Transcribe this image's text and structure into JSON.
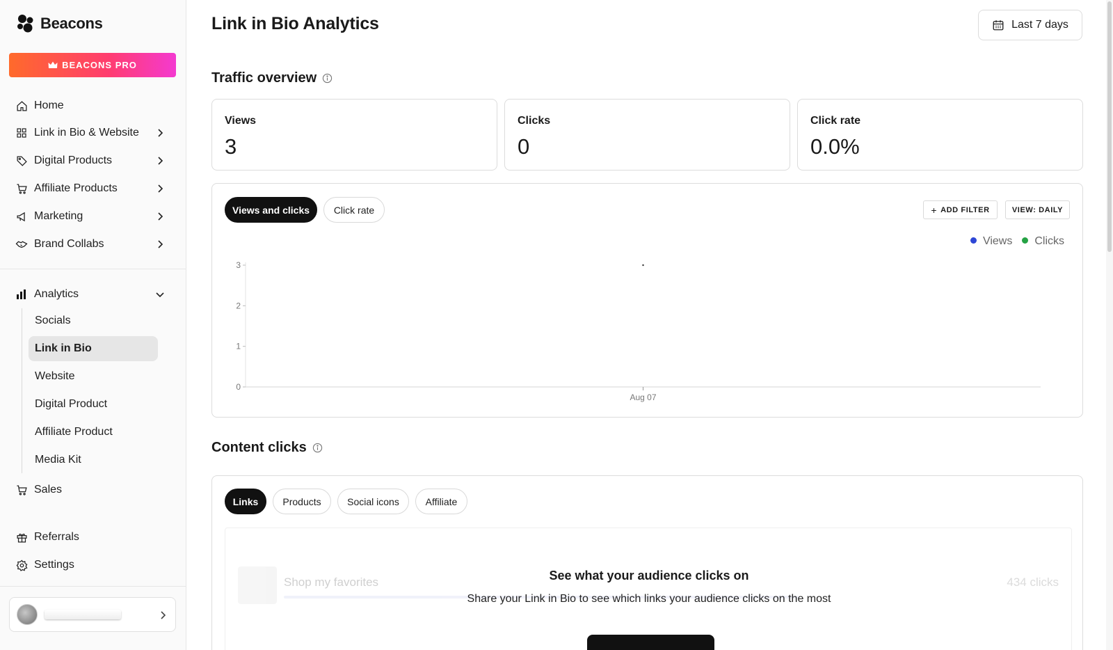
{
  "brand": {
    "name": "Beacons",
    "pro_label": "BEACONS PRO",
    "pro_gradient": [
      "#ff6a2b",
      "#ff3c70",
      "#f43ad0"
    ]
  },
  "sidebar": {
    "items": [
      {
        "label": "Home",
        "icon": "home-icon",
        "has_chevron": false
      },
      {
        "label": "Link in Bio & Website",
        "icon": "grid-icon",
        "has_chevron": true
      },
      {
        "label": "Digital Products",
        "icon": "tag-icon",
        "has_chevron": true
      },
      {
        "label": "Affiliate Products",
        "icon": "cart-icon",
        "has_chevron": true
      },
      {
        "label": "Marketing",
        "icon": "megaphone-icon",
        "has_chevron": true
      },
      {
        "label": "Brand Collabs",
        "icon": "handshake-icon",
        "has_chevron": true
      }
    ],
    "analytics": {
      "label": "Analytics",
      "icon": "bar-chart-icon",
      "expanded": true,
      "sub_items": [
        {
          "label": "Socials",
          "active": false
        },
        {
          "label": "Link in Bio",
          "active": true
        },
        {
          "label": "Website",
          "active": false
        },
        {
          "label": "Digital Product",
          "active": false
        },
        {
          "label": "Affiliate Product",
          "active": false
        },
        {
          "label": "Media Kit",
          "active": false
        }
      ]
    },
    "sales": {
      "label": "Sales",
      "icon": "cart-icon"
    },
    "bottom_items": [
      {
        "label": "Referrals",
        "icon": "gift-icon"
      },
      {
        "label": "Settings",
        "icon": "gear-icon"
      }
    ]
  },
  "header": {
    "title": "Link in Bio Analytics",
    "date_range": "Last 7 days"
  },
  "traffic": {
    "title": "Traffic overview",
    "stats": [
      {
        "label": "Views",
        "value": "3"
      },
      {
        "label": "Clicks",
        "value": "0"
      },
      {
        "label": "Click rate",
        "value": "0.0%"
      }
    ],
    "tabs": [
      {
        "label": "Views and clicks",
        "active": true
      },
      {
        "label": "Click rate",
        "active": false
      }
    ],
    "add_filter": "ADD FILTER",
    "view_mode": "VIEW: DAILY",
    "legend": [
      {
        "name": "Views",
        "color": "#2e47d6"
      },
      {
        "name": "Clicks",
        "color": "#25a244"
      }
    ]
  },
  "chart_data": {
    "type": "line",
    "x": [
      "Aug 07"
    ],
    "series": [
      {
        "name": "Views",
        "values": [
          3
        ]
      },
      {
        "name": "Clicks",
        "values": [
          0
        ]
      }
    ],
    "yticks": [
      0,
      1,
      2,
      3
    ],
    "ylim": [
      0,
      3
    ],
    "legend_position": "top-right",
    "grid": false
  },
  "content_clicks": {
    "title": "Content clicks",
    "tabs": [
      {
        "label": "Links",
        "active": true
      },
      {
        "label": "Products",
        "active": false
      },
      {
        "label": "Social icons",
        "active": false
      },
      {
        "label": "Affiliate",
        "active": false
      }
    ],
    "placeholder_row": {
      "title": "Shop my favorites",
      "clicks": "434 clicks"
    },
    "empty_title": "See what your audience clicks on",
    "empty_subtitle": "Share your Link in Bio to see which links your audience clicks on the most"
  }
}
